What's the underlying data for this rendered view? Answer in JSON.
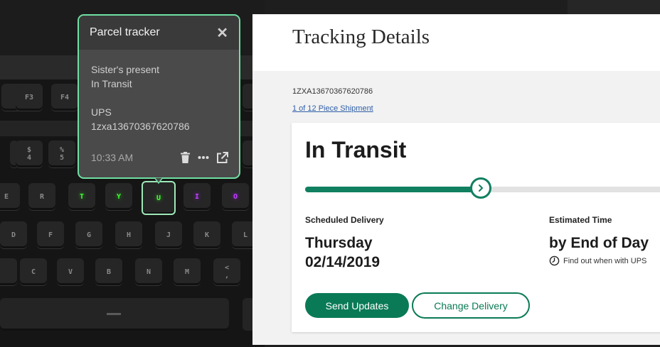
{
  "keyboard": {
    "row_f": [
      "F3",
      "F4"
    ],
    "row_num": [
      "$\n4",
      "%\n5"
    ],
    "row_qwerty": [
      "E",
      "R",
      "T",
      "Y",
      "U",
      "I",
      "O"
    ],
    "row_home": [
      "D",
      "F",
      "G",
      "H",
      "J",
      "K",
      "L"
    ],
    "row_bottom": [
      "C",
      "V",
      "B",
      "N",
      "M",
      "<\n,"
    ],
    "glow_colors": {
      "green": "#3dff2f",
      "purple": "#c040ff"
    }
  },
  "popup": {
    "title": "Parcel tracker",
    "close_icon": "close-icon",
    "item_name": "Sister's present",
    "item_status": "In Transit",
    "carrier": "UPS",
    "tracking_number": "1zxa13670367620786",
    "time": "10:33 AM",
    "actions": [
      "trash-icon",
      "more-icon",
      "external-link-icon"
    ],
    "border_color": "#6fe0a3"
  },
  "tracking_page": {
    "title": "Tracking Details",
    "tracking_number": "1ZXA13670367620786",
    "piece_link": "1 of 12 Piece Shipment",
    "status": "In Transit",
    "progress_fraction": 0.48,
    "scheduled_label": "Scheduled Delivery",
    "scheduled_day": "Thursday",
    "scheduled_date": "02/14/2019",
    "estimated_label": "Estimated Time",
    "estimated_value": "by End of Day",
    "find_out_text": "Find out when with UPS",
    "send_updates_label": "Send Updates",
    "change_delivery_label": "Change Delivery",
    "accent_color": "#0a7a56"
  }
}
